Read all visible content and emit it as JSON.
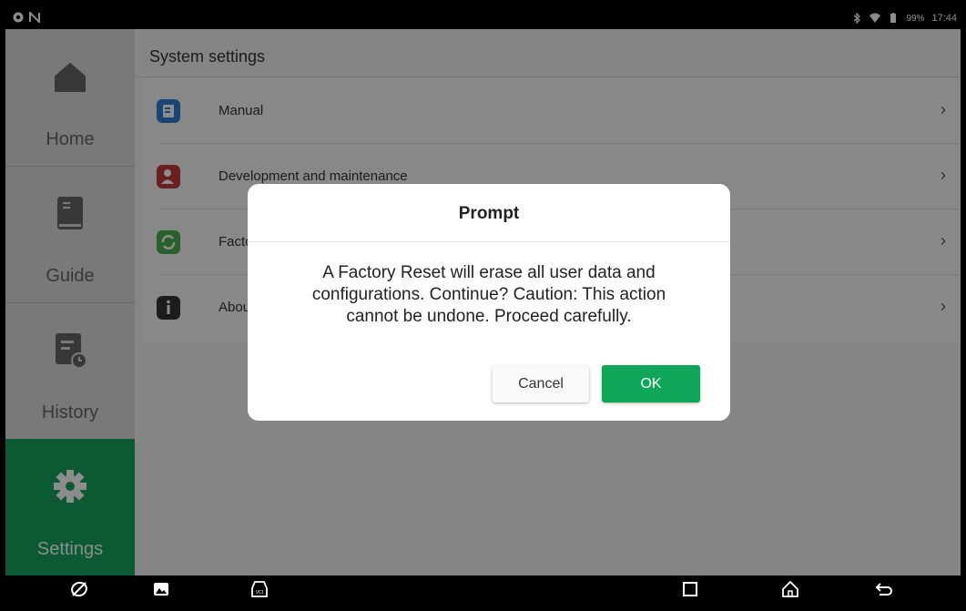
{
  "status_bar": {
    "battery": "99%",
    "time": "17:44",
    "left_icons": [
      "chrome-icon",
      "n-notification-icon"
    ],
    "right_icons": [
      "bluetooth-icon",
      "wifi-icon",
      "battery-icon"
    ]
  },
  "sidebar": {
    "items": [
      {
        "label": "Home",
        "icon": "home-icon",
        "active": false
      },
      {
        "label": "Guide",
        "icon": "book-icon",
        "active": false
      },
      {
        "label": "History",
        "icon": "history-icon",
        "active": false
      },
      {
        "label": "Settings",
        "icon": "gear-icon",
        "active": true
      }
    ]
  },
  "main": {
    "title": "System settings",
    "list": [
      {
        "label": "Manual",
        "icon": "manual-icon",
        "color": "#2d7fd3"
      },
      {
        "label": "Development and maintenance",
        "icon": "developer-icon",
        "color": "#c23b3b"
      },
      {
        "label": "Factory reset",
        "icon": "reset-icon",
        "color": "#4caf50"
      },
      {
        "label": "About",
        "icon": "info-icon",
        "color": "#333333"
      }
    ]
  },
  "dialog": {
    "title": "Prompt",
    "message_line1": "A Factory Reset will erase all user data and",
    "message_line2": "configurations. Continue? Caution: This action",
    "message_line3": "cannot be undone. Proceed carefully.",
    "cancel_label": "Cancel",
    "ok_label": "OK"
  },
  "nav_bar": {
    "icons": [
      "app-logo-icon",
      "gallery-icon",
      "vci-icon",
      "recents-icon",
      "home-nav-icon",
      "back-icon"
    ]
  },
  "colors": {
    "accent": "#15a55f",
    "ok_button": "#0fa65a"
  }
}
